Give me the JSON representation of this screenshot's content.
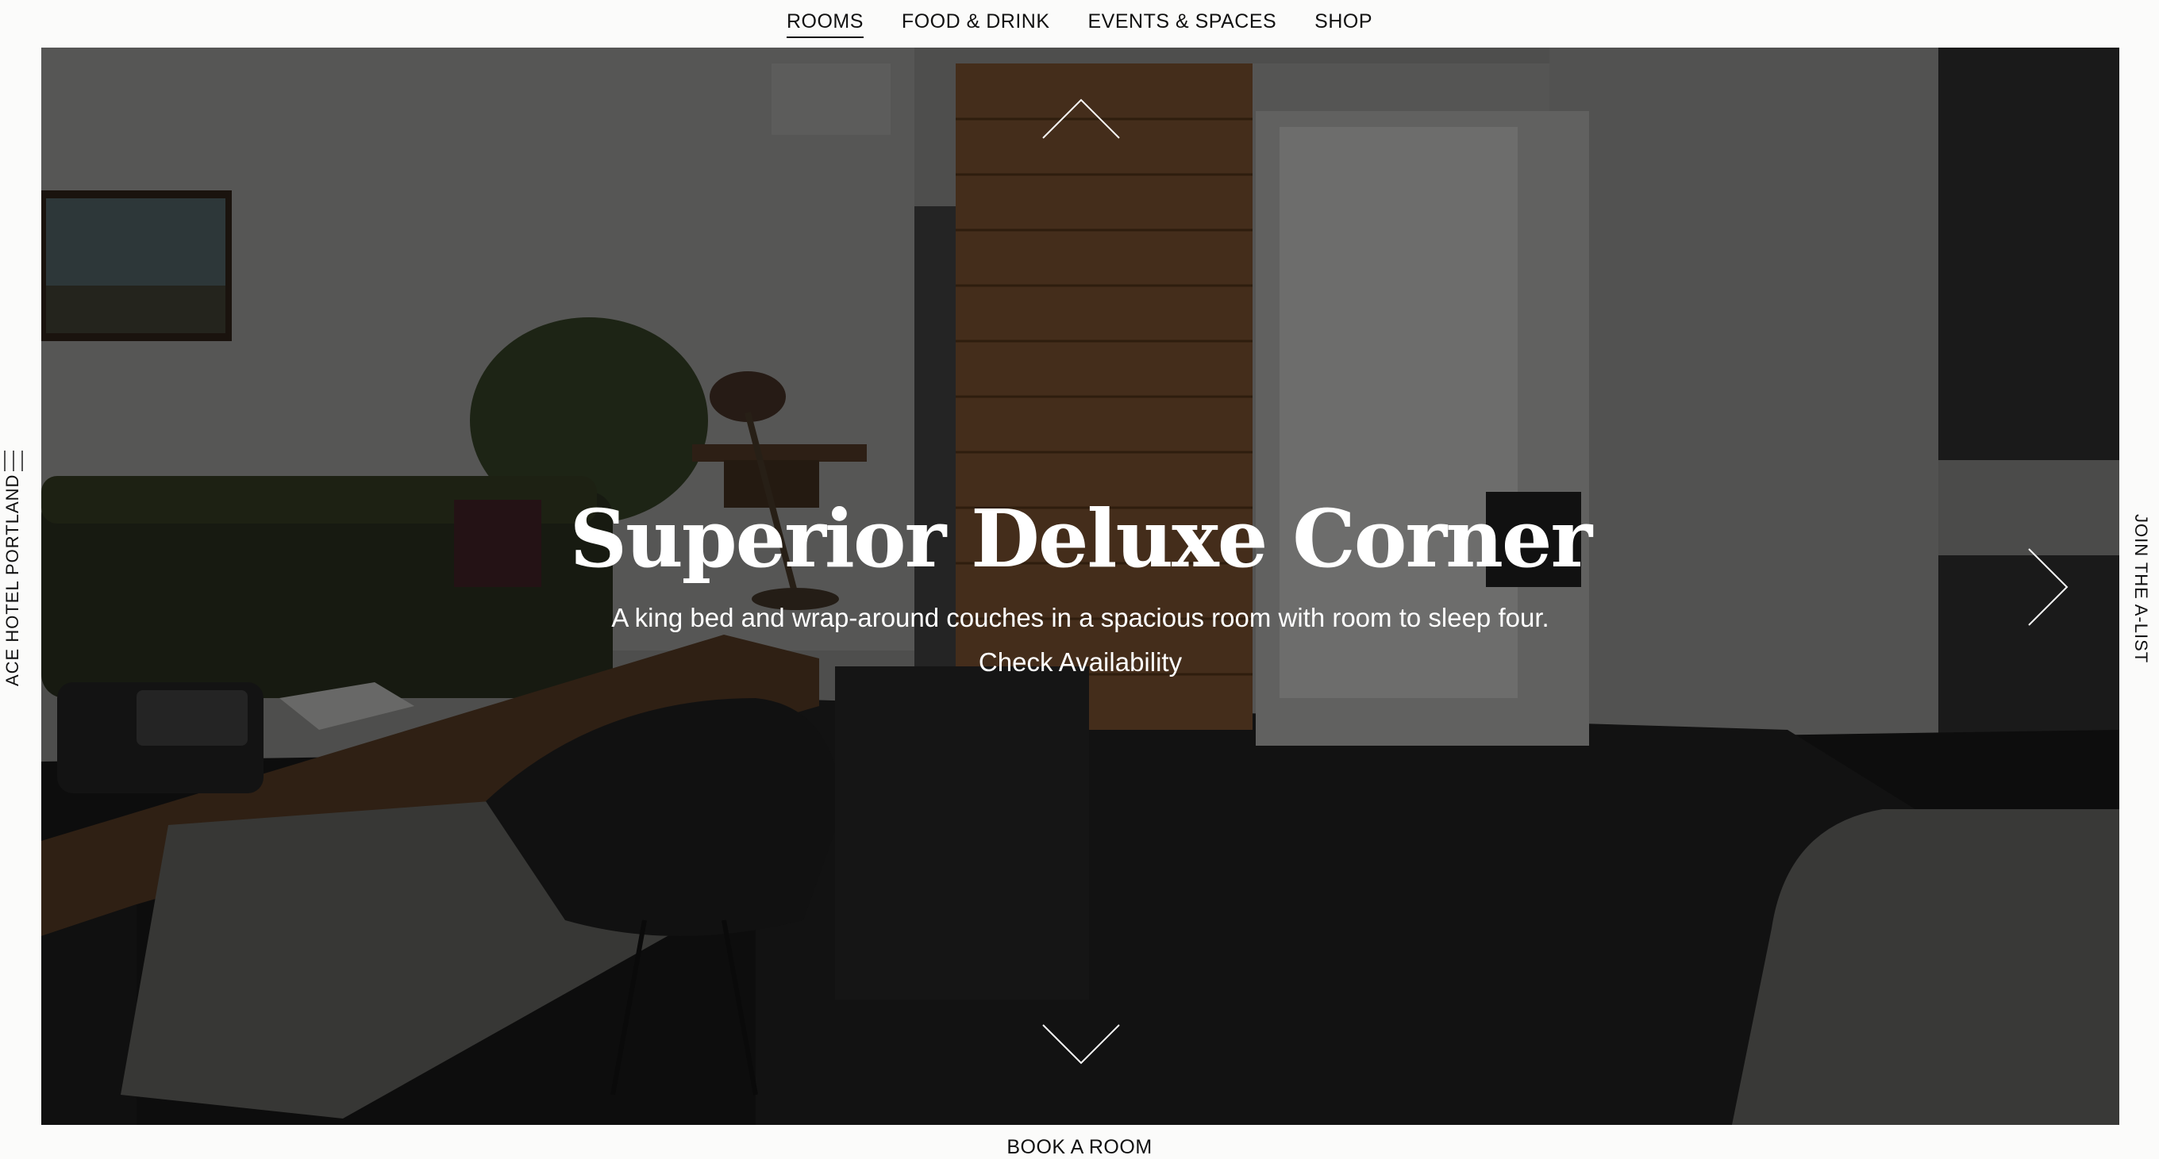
{
  "nav": {
    "items": [
      {
        "label": "ROOMS",
        "active": true
      },
      {
        "label": "FOOD & DRINK",
        "active": false
      },
      {
        "label": "EVENTS & SPACES",
        "active": false
      },
      {
        "label": "SHOP",
        "active": false
      }
    ]
  },
  "sidebar": {
    "menu_icon": "hamburger-vertical-icon",
    "brand": "ACE HOTEL PORTLAND"
  },
  "right_rail": {
    "join": "JOIN THE A-LIST"
  },
  "hero": {
    "title": "Superior Deluxe Corner",
    "description": "A king bed and wrap-around couches in a spacious room with room to sleep four.",
    "cta": "Check Availability",
    "prev_icon": "chevron-up-icon",
    "next_icon": "chevron-down-icon",
    "forward_icon": "chevron-right-icon"
  },
  "footer": {
    "book": "BOOK A ROOM"
  }
}
